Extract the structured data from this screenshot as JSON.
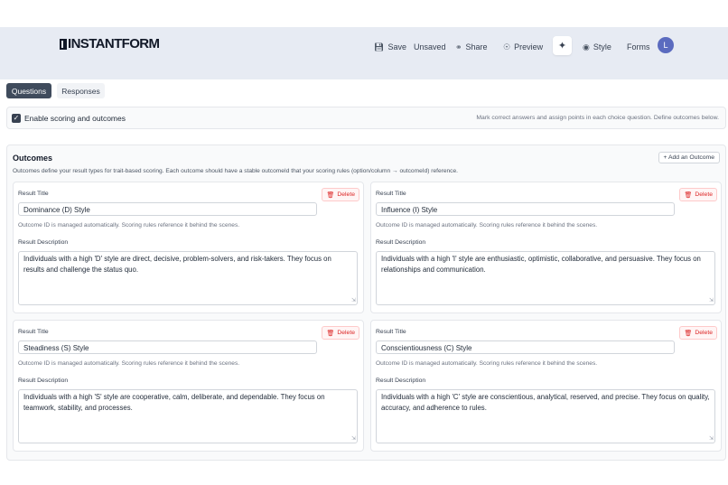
{
  "app": {
    "logo_text": "INSTANTFORM",
    "user_initial": "L"
  },
  "nav": {
    "save": "Save",
    "unsaved": "Unsaved",
    "share": "Share",
    "preview": "Preview",
    "style": "Style",
    "forms": "Forms"
  },
  "icons": {
    "save": "save-icon",
    "share": "share-icon",
    "preview": "eye-icon",
    "wand": "magic-wand-icon",
    "style": "palette-icon",
    "delete": "trash-icon"
  },
  "tabs": [
    {
      "label": "Questions",
      "active": true
    },
    {
      "label": "Responses",
      "active": false
    }
  ],
  "scoring": {
    "checked": true,
    "label": "Enable scoring and outcomes",
    "hint": "Mark correct answers and assign points in each choice question. Define outcomes below."
  },
  "outcomes": {
    "title": "Outcomes",
    "description": "Outcomes define your result types for trait-based scoring. Each outcome should have a stable outcomeId that your scoring rules (option/column → outcomeId) reference.",
    "add_label": "+ Add an Outcome",
    "result_title_label": "Result Title",
    "result_description_label": "Result Description",
    "managed_note": "Outcome ID is managed automatically. Scoring rules reference it behind the scenes.",
    "delete_label": "Delete",
    "items": [
      {
        "title": "Dominance (D) Style",
        "description": "Individuals with a high 'D' style are direct, decisive, problem-solvers, and risk-takers. They focus on results and challenge the status quo."
      },
      {
        "title": "Influence (I) Style",
        "description": "Individuals with a high 'I' style are enthusiastic, optimistic, collaborative, and persuasive. They focus on relationships and communication."
      },
      {
        "title": "Steadiness (S) Style",
        "description": "Individuals with a high 'S' style are cooperative, calm, deliberate, and dependable. They focus on teamwork, stability, and processes."
      },
      {
        "title": "Conscientiousness (C) Style",
        "description": "Individuals with a high 'C' style are conscientious, analytical, reserved, and precise. They focus on quality, accuracy, and adherence to rules."
      }
    ]
  },
  "colors": {
    "header_bg": "#e7ebf3",
    "active_tab": "#3f4b5c",
    "avatar": "#5b6bbf",
    "delete": "#dc2626"
  }
}
